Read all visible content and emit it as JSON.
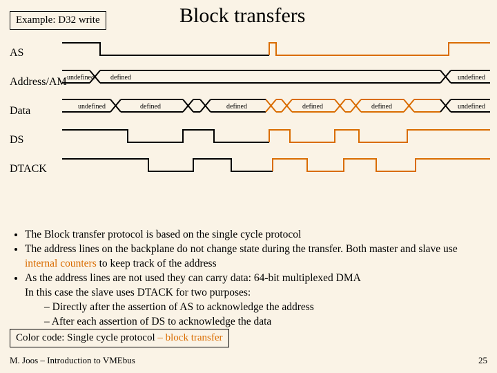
{
  "example_label": "Example: D32 write",
  "title": "Block transfers",
  "signals": {
    "as": "AS",
    "addr": "Address/AM",
    "data": "Data",
    "ds": "DS",
    "dtack": "DTACK"
  },
  "segs": {
    "undef": "undefined",
    "def": "defined"
  },
  "bullets": {
    "b1": "The Block transfer protocol is based on the single cycle protocol",
    "b2a": "The address lines on the backplane do not change state during the transfer. Both master and slave use ",
    "b2b": "internal counters",
    "b2c": " to keep track of the address",
    "b3a": "As the address lines are not used they can carry data: 64-bit multiplexed DMA",
    "b3b": "In this case the slave uses DTACK for two purposes:",
    "b3s1": "Directly after the assertion of AS to acknowledge the address",
    "b3s2": "After each assertion of DS to acknowledge the data"
  },
  "colorcode": {
    "a": "Color code: Single cycle protocol ",
    "b": "– block transfer"
  },
  "footer": "M. Joos – Introduction to VMEbus",
  "pagenum": "25",
  "chart_data": {
    "type": "timing-diagram",
    "x_range": [
      0,
      620
    ],
    "legend": {
      "black": "single cycle protocol",
      "orange": "block transfer"
    },
    "signals": [
      {
        "name": "AS",
        "kind": "digital-level",
        "levels": [
          {
            "x0": 0,
            "x1": 55,
            "level": "high",
            "phase": "black"
          },
          {
            "x0": 55,
            "x1": 300,
            "level": "low",
            "phase": "black"
          },
          {
            "x0": 300,
            "x1": 310,
            "level": "high",
            "phase": "black"
          },
          {
            "x0": 310,
            "x1": 560,
            "level": "low",
            "phase": "orange"
          },
          {
            "x0": 560,
            "x1": 620,
            "level": "high",
            "phase": "orange"
          }
        ]
      },
      {
        "name": "Address/AM",
        "kind": "bus",
        "segments": [
          {
            "x0": 0,
            "x1": 50,
            "state": "undefined",
            "phase": "black"
          },
          {
            "x0": 50,
            "x1": 560,
            "state": "defined",
            "phase": "black"
          },
          {
            "x0": 560,
            "x1": 620,
            "state": "undefined",
            "phase": "black"
          }
        ]
      },
      {
        "name": "Data",
        "kind": "bus",
        "segments": [
          {
            "x0": 0,
            "x1": 80,
            "state": "undefined",
            "phase": "black"
          },
          {
            "x0": 80,
            "x1": 180,
            "state": "defined",
            "phase": "black"
          },
          {
            "x0": 180,
            "x1": 210,
            "state": "undefined",
            "phase": "black"
          },
          {
            "x0": 210,
            "x1": 300,
            "state": "defined",
            "phase": "black"
          },
          {
            "x0": 300,
            "x1": 320,
            "state": "undefined",
            "phase": "orange"
          },
          {
            "x0": 320,
            "x1": 400,
            "state": "defined",
            "phase": "orange"
          },
          {
            "x0": 400,
            "x1": 420,
            "state": "undefined",
            "phase": "orange"
          },
          {
            "x0": 420,
            "x1": 500,
            "state": "defined",
            "phase": "orange"
          },
          {
            "x0": 500,
            "x1": 560,
            "state": "undefined",
            "phase": "orange"
          },
          {
            "x0": 560,
            "x1": 620,
            "state": "undefined",
            "phase": "black"
          }
        ]
      },
      {
        "name": "DS",
        "kind": "digital-level",
        "levels": [
          {
            "x0": 0,
            "x1": 95,
            "level": "high",
            "phase": "black"
          },
          {
            "x0": 95,
            "x1": 175,
            "level": "low",
            "phase": "black"
          },
          {
            "x0": 175,
            "x1": 220,
            "level": "high",
            "phase": "black"
          },
          {
            "x0": 220,
            "x1": 300,
            "level": "low",
            "phase": "black"
          },
          {
            "x0": 300,
            "x1": 330,
            "level": "high",
            "phase": "orange"
          },
          {
            "x0": 330,
            "x1": 395,
            "level": "low",
            "phase": "orange"
          },
          {
            "x0": 395,
            "x1": 430,
            "level": "high",
            "phase": "orange"
          },
          {
            "x0": 430,
            "x1": 500,
            "level": "low",
            "phase": "orange"
          },
          {
            "x0": 500,
            "x1": 620,
            "level": "high",
            "phase": "orange"
          }
        ]
      },
      {
        "name": "DTACK",
        "kind": "digital-level",
        "levels": [
          {
            "x0": 0,
            "x1": 125,
            "level": "high",
            "phase": "black"
          },
          {
            "x0": 125,
            "x1": 190,
            "level": "low",
            "phase": "black"
          },
          {
            "x0": 190,
            "x1": 245,
            "level": "high",
            "phase": "black"
          },
          {
            "x0": 245,
            "x1": 305,
            "level": "low",
            "phase": "black"
          },
          {
            "x0": 305,
            "x1": 355,
            "level": "high",
            "phase": "orange"
          },
          {
            "x0": 355,
            "x1": 408,
            "level": "low",
            "phase": "orange"
          },
          {
            "x0": 408,
            "x1": 455,
            "level": "high",
            "phase": "orange"
          },
          {
            "x0": 455,
            "x1": 512,
            "level": "low",
            "phase": "orange"
          },
          {
            "x0": 512,
            "x1": 620,
            "level": "high",
            "phase": "orange"
          }
        ]
      }
    ]
  }
}
